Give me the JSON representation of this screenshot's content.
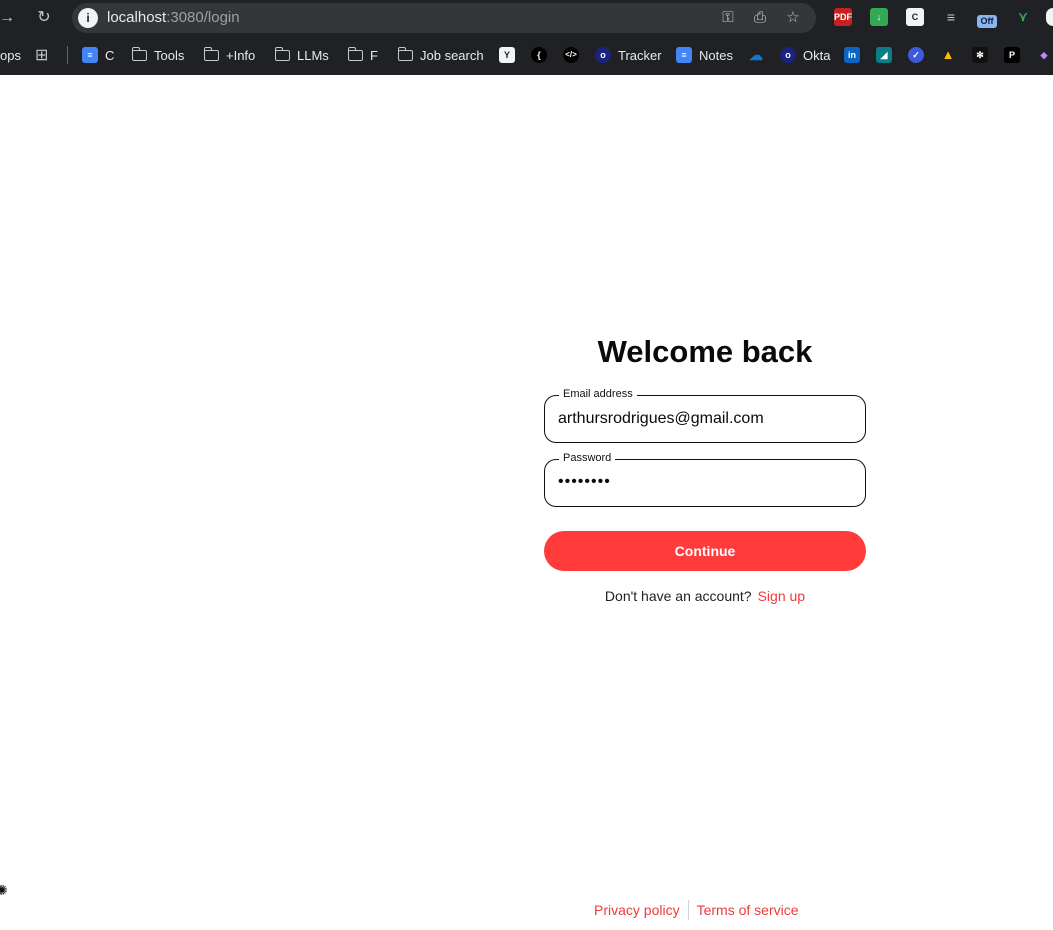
{
  "browser": {
    "url_host": "localhost",
    "url_path": ":3080/login",
    "bookmarks": [
      {
        "label": "ops",
        "icon": "partial-icon"
      },
      {
        "label": "",
        "icon": "apps-grid-icon"
      },
      {
        "label": "C",
        "icon": "docs-icon"
      },
      {
        "label": "Tools",
        "icon": "folder-icon"
      },
      {
        "label": "+Info",
        "icon": "folder-icon"
      },
      {
        "label": "LLMs",
        "icon": "folder-icon"
      },
      {
        "label": "F",
        "icon": "folder-icon"
      },
      {
        "label": "Job search",
        "icon": "folder-icon"
      },
      {
        "label": "Tracker",
        "icon": "tracker-icon"
      },
      {
        "label": "Notes",
        "icon": "docs-icon"
      },
      {
        "label": "Okta",
        "icon": "okta-icon"
      }
    ],
    "extension_badge": "Off"
  },
  "login": {
    "title": "Welcome back",
    "email_label": "Email address",
    "email_value": "arthursrodrigues@gmail.com",
    "password_label": "Password",
    "password_value": "••••••••",
    "continue_label": "Continue",
    "no_account_text": "Don't have an account?",
    "signup_label": "Sign up"
  },
  "footer": {
    "privacy_label": "Privacy policy",
    "terms_label": "Terms of service"
  },
  "colors": {
    "accent": "#ff3b3b",
    "link": "#ef3b3b",
    "chrome_bg": "#202124"
  }
}
